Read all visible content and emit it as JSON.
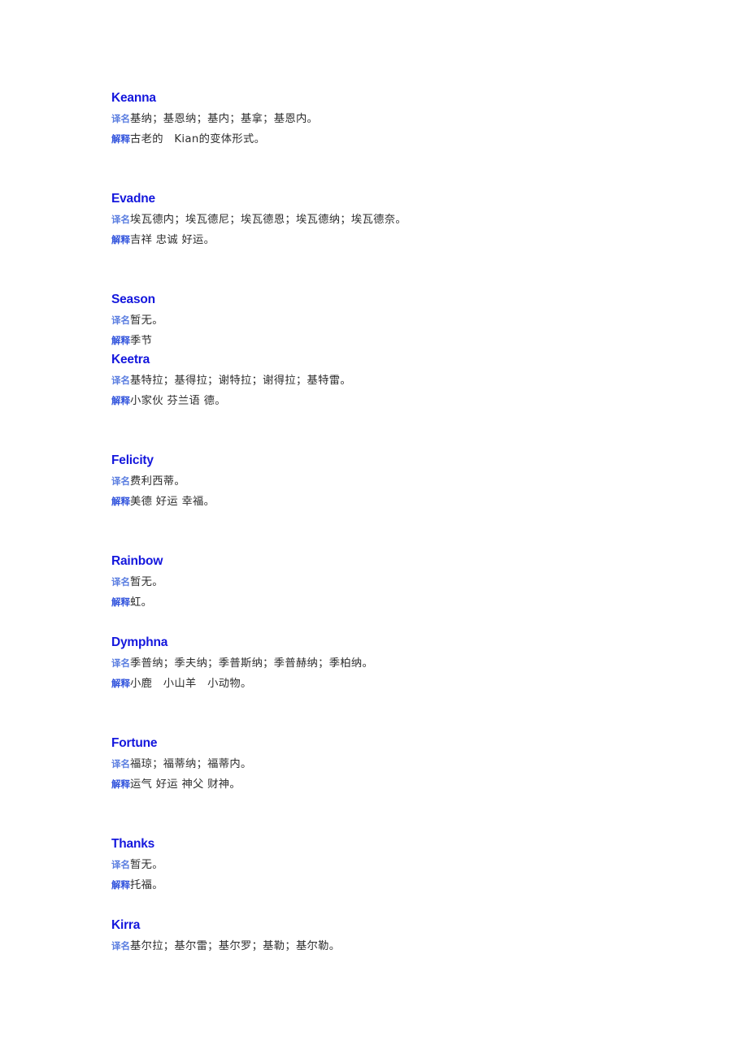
{
  "page": {
    "background_color": "#ffffff",
    "name_color": "#1417dd",
    "label_color": "#5a7de0",
    "label_strong_color": "#3355dd",
    "text_color": "#2e2e2e"
  },
  "labels": {
    "translation": "译名",
    "explanation": "解释"
  },
  "entries": [
    {
      "name": "Keanna",
      "translation": "基纳；基恩纳；基内；基拿；基恩内。",
      "explanation_pre": "古老的　",
      "explanation_latin": "Kian",
      "explanation_post": "的变体形式。",
      "spacing": "gap-large"
    },
    {
      "name": "Evadne",
      "translation": "埃瓦德内；埃瓦德尼；埃瓦德恩；埃瓦德纳；埃瓦德奈。",
      "explanation": "吉祥 忠诚 好运。",
      "spacing": "gap-large"
    },
    {
      "name": "Season",
      "translation": "暂无。",
      "explanation": "季节",
      "spacing": "gap-none"
    },
    {
      "name": "Keetra",
      "translation": "基特拉；基得拉；谢特拉；谢得拉；基特雷。",
      "explanation": "小家伙 芬兰语 德。",
      "spacing": "gap-large"
    },
    {
      "name": "Felicity",
      "translation": "费利西蒂。",
      "explanation": "美德 好运 幸福。",
      "spacing": "gap-large"
    },
    {
      "name": "Rainbow",
      "translation": "暂无。",
      "explanation": "虹。",
      "spacing": "gap-medium"
    },
    {
      "name": "Dymphna",
      "translation": "季普纳；季夫纳；季普斯纳；季普赫纳；季柏纳。",
      "explanation": "小鹿　小山羊　小动物。",
      "spacing": "gap-large"
    },
    {
      "name": "Fortune",
      "translation": "福琼；福蒂纳；福蒂内。",
      "explanation": "运气 好运 神父 财神。",
      "spacing": "gap-large"
    },
    {
      "name": "Thanks",
      "translation": "暂无。",
      "explanation": "托福。",
      "spacing": "gap-medium"
    },
    {
      "name": "Kirra",
      "translation": "基尔拉；基尔雷；基尔罗；基勒；基尔勒。",
      "explanation": null,
      "spacing": "gap-none"
    }
  ]
}
